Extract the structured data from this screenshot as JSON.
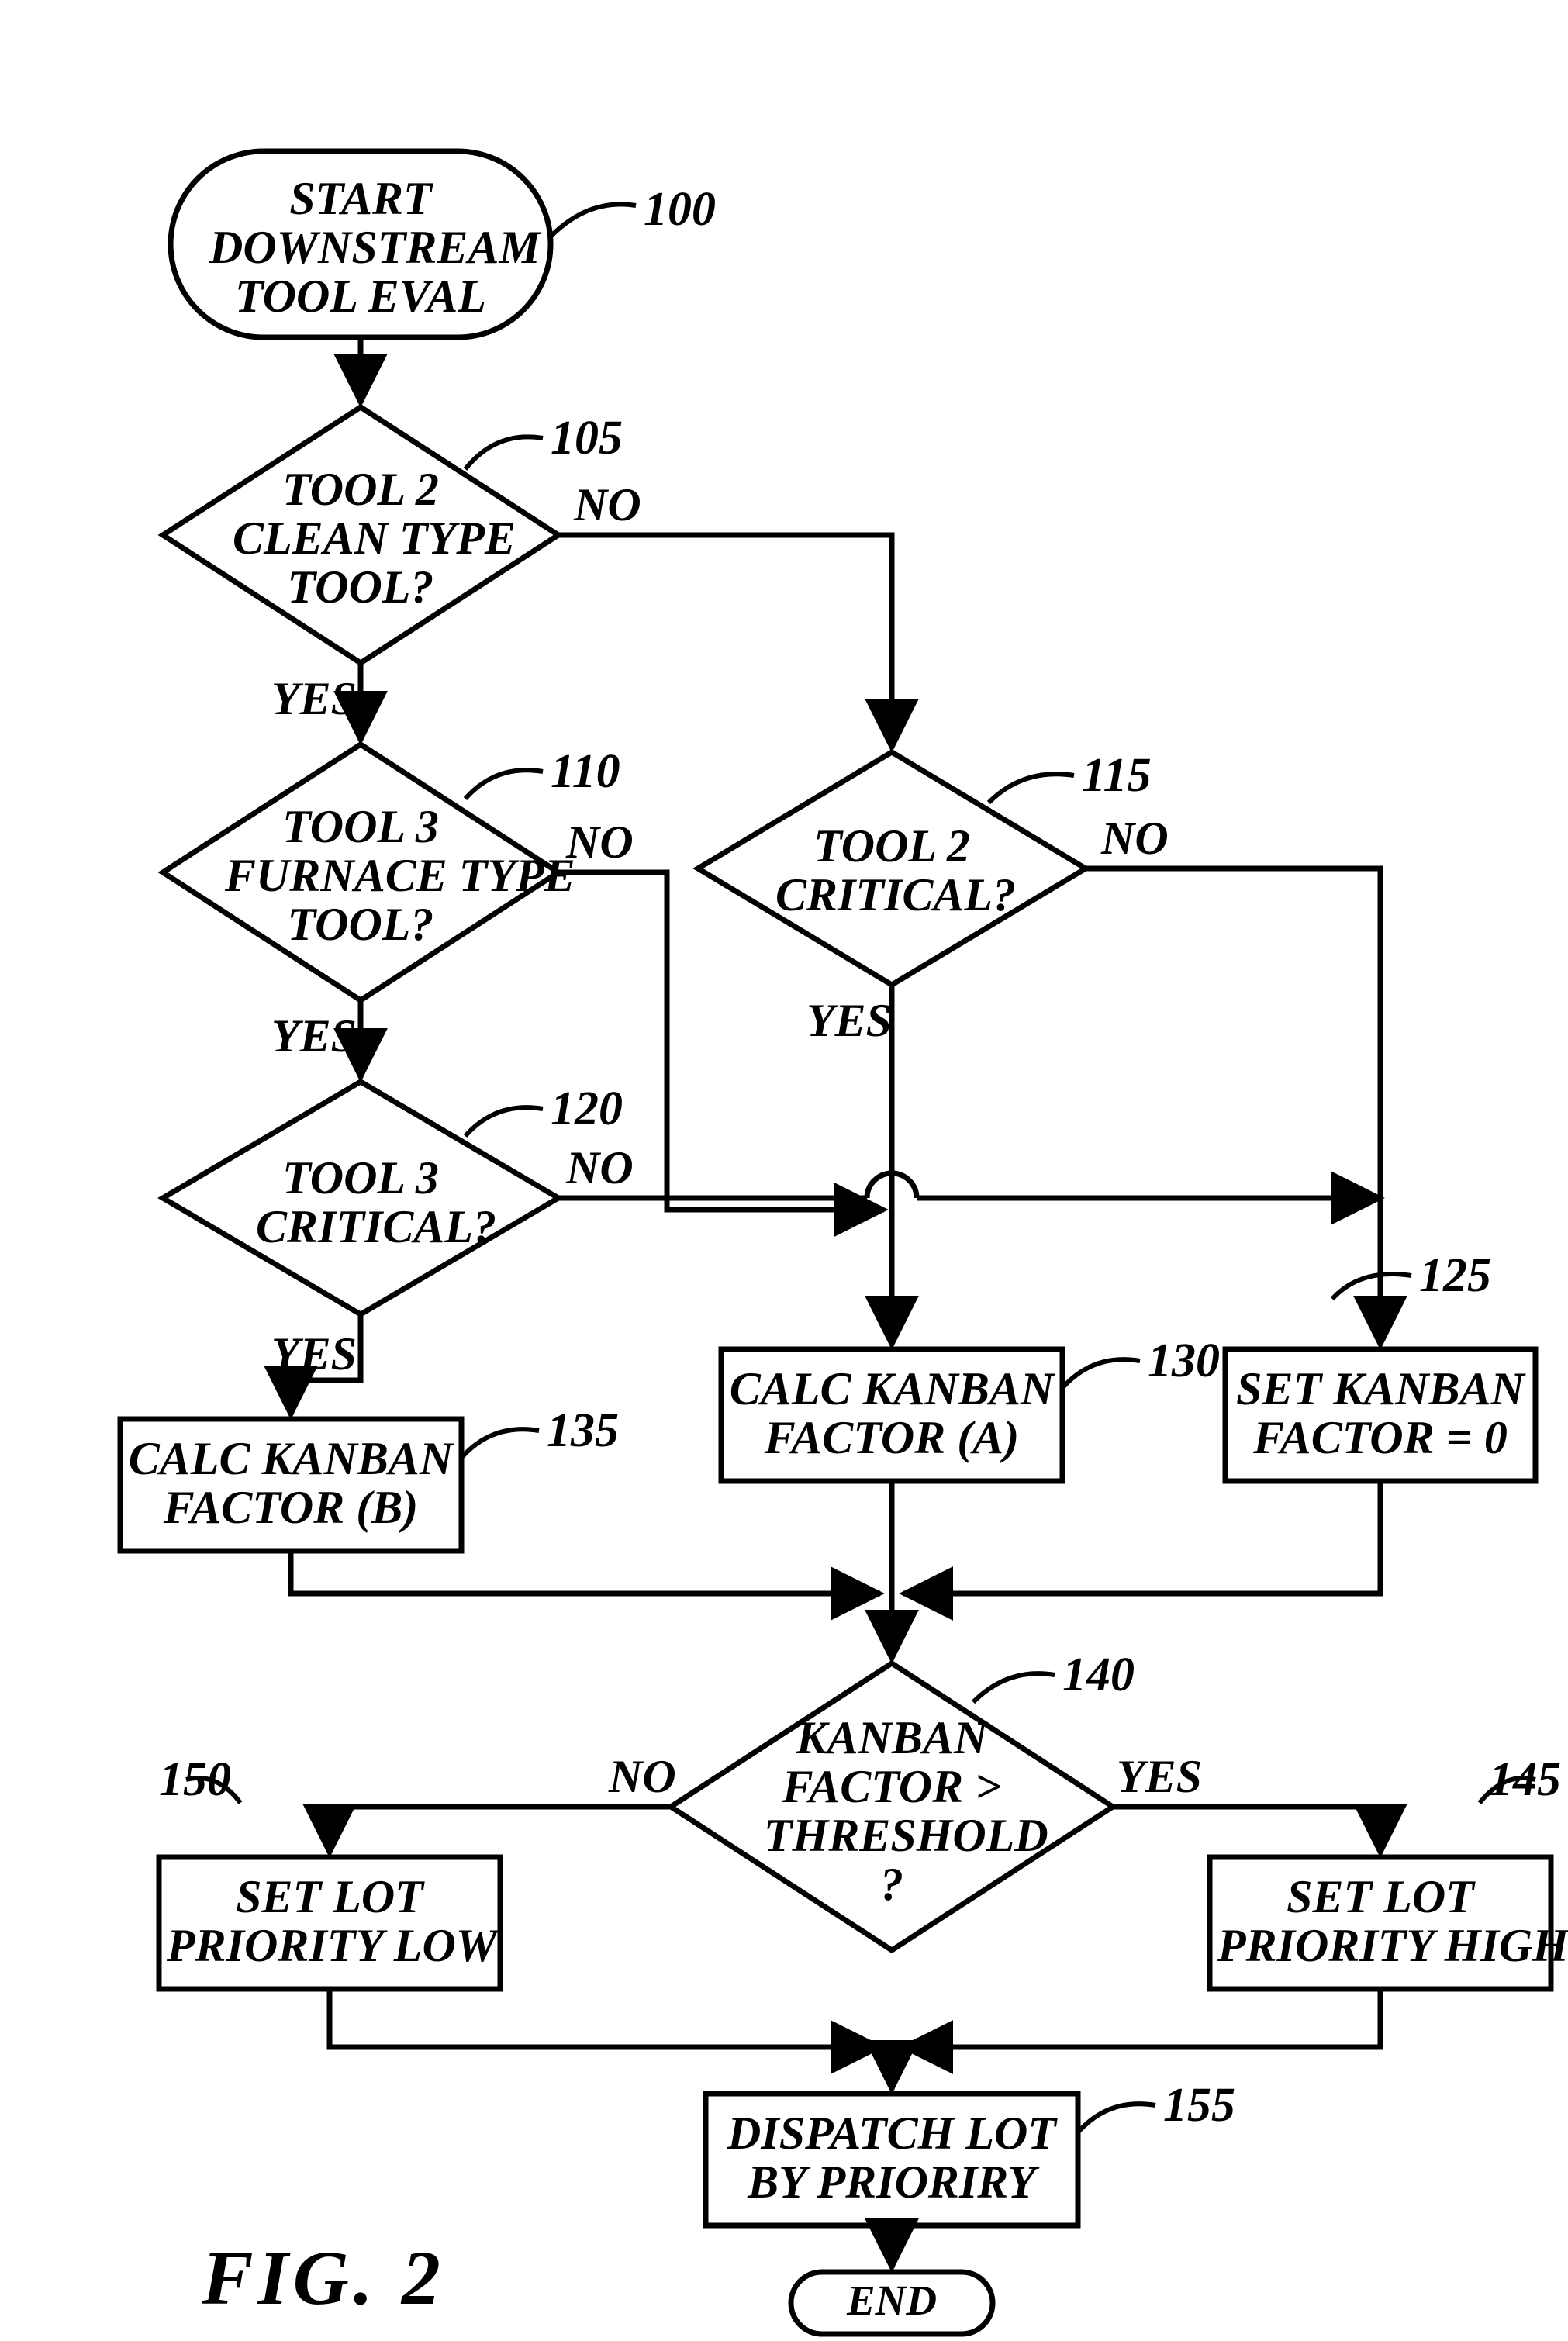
{
  "chart_data": {
    "type": "flowchart",
    "title": "FIG. 2",
    "nodes": [
      {
        "id": "100",
        "kind": "terminator",
        "text": "START\nDOWNSTREAM\nTOOL EVAL"
      },
      {
        "id": "105",
        "kind": "decision",
        "text": "TOOL 2\nCLEAN TYPE\nTOOL?"
      },
      {
        "id": "110",
        "kind": "decision",
        "text": "TOOL 3\nFURNACE TYPE\nTOOL?"
      },
      {
        "id": "115",
        "kind": "decision",
        "text": "TOOL 2\nCRITICAL?"
      },
      {
        "id": "120",
        "kind": "decision",
        "text": "TOOL 3\nCRITICAL?"
      },
      {
        "id": "125",
        "kind": "process",
        "text": "SET KANBAN\nFACTOR = 0"
      },
      {
        "id": "130",
        "kind": "process",
        "text": "CALC KANBAN\nFACTOR (A)"
      },
      {
        "id": "135",
        "kind": "process",
        "text": "CALC KANBAN\nFACTOR (B)"
      },
      {
        "id": "140",
        "kind": "decision",
        "text": "KANBAN\nFACTOR >\nTHRESHOLD\n?"
      },
      {
        "id": "145",
        "kind": "process",
        "text": "SET LOT\nPRIORITY HIGH"
      },
      {
        "id": "150",
        "kind": "process",
        "text": "SET LOT\nPRIORITY LOW"
      },
      {
        "id": "155",
        "kind": "process",
        "text": "DISPATCH LOT\nBY PRIORIRY"
      },
      {
        "id": "END",
        "kind": "terminator",
        "text": "END"
      }
    ],
    "edges": [
      {
        "from": "100",
        "to": "105",
        "label": ""
      },
      {
        "from": "105",
        "to": "110",
        "label": "YES"
      },
      {
        "from": "105",
        "to": "115",
        "label": "NO"
      },
      {
        "from": "110",
        "to": "120",
        "label": "YES"
      },
      {
        "from": "110",
        "to": "130",
        "label": "NO",
        "note": "joins 115 YES"
      },
      {
        "from": "115",
        "to": "130",
        "label": "YES"
      },
      {
        "from": "115",
        "to": "125",
        "label": "NO"
      },
      {
        "from": "120",
        "to": "135",
        "label": "YES"
      },
      {
        "from": "120",
        "to": "125",
        "label": "NO",
        "note": "bridges over 130 line"
      },
      {
        "from": "125",
        "to": "140",
        "label": ""
      },
      {
        "from": "130",
        "to": "140",
        "label": ""
      },
      {
        "from": "135",
        "to": "140",
        "label": ""
      },
      {
        "from": "140",
        "to": "150",
        "label": "NO"
      },
      {
        "from": "140",
        "to": "145",
        "label": "YES"
      },
      {
        "from": "145",
        "to": "155",
        "label": ""
      },
      {
        "from": "150",
        "to": "155",
        "label": ""
      },
      {
        "from": "155",
        "to": "END",
        "label": ""
      }
    ]
  },
  "refs": {
    "r100": "100",
    "r105": "105",
    "r110": "110",
    "r115": "115",
    "r120": "120",
    "r125": "125",
    "r130": "130",
    "r135": "135",
    "r140": "140",
    "r145": "145",
    "r150": "150",
    "r155": "155"
  },
  "labels": {
    "n100": "START\nDOWNSTREAM\nTOOL EVAL",
    "n105": "TOOL 2\nCLEAN TYPE\nTOOL?",
    "n110": "TOOL 3\nFURNACE TYPE\nTOOL?",
    "n115": "TOOL 2\nCRITICAL?",
    "n120": "TOOL 3\nCRITICAL?",
    "n125": "SET KANBAN\nFACTOR = 0",
    "n130": "CALC KANBAN\nFACTOR (A)",
    "n135": "CALC KANBAN\nFACTOR (B)",
    "n140": "KANBAN\nFACTOR >\nTHRESHOLD\n?",
    "n145": "SET LOT\nPRIORITY HIGH",
    "n150": "SET LOT\nPRIORITY LOW",
    "n155": "DISPATCH LOT\nBY PRIORIRY",
    "nEND": "END",
    "yes": "YES",
    "no": "NO"
  },
  "figcaption": "FIG.  2"
}
